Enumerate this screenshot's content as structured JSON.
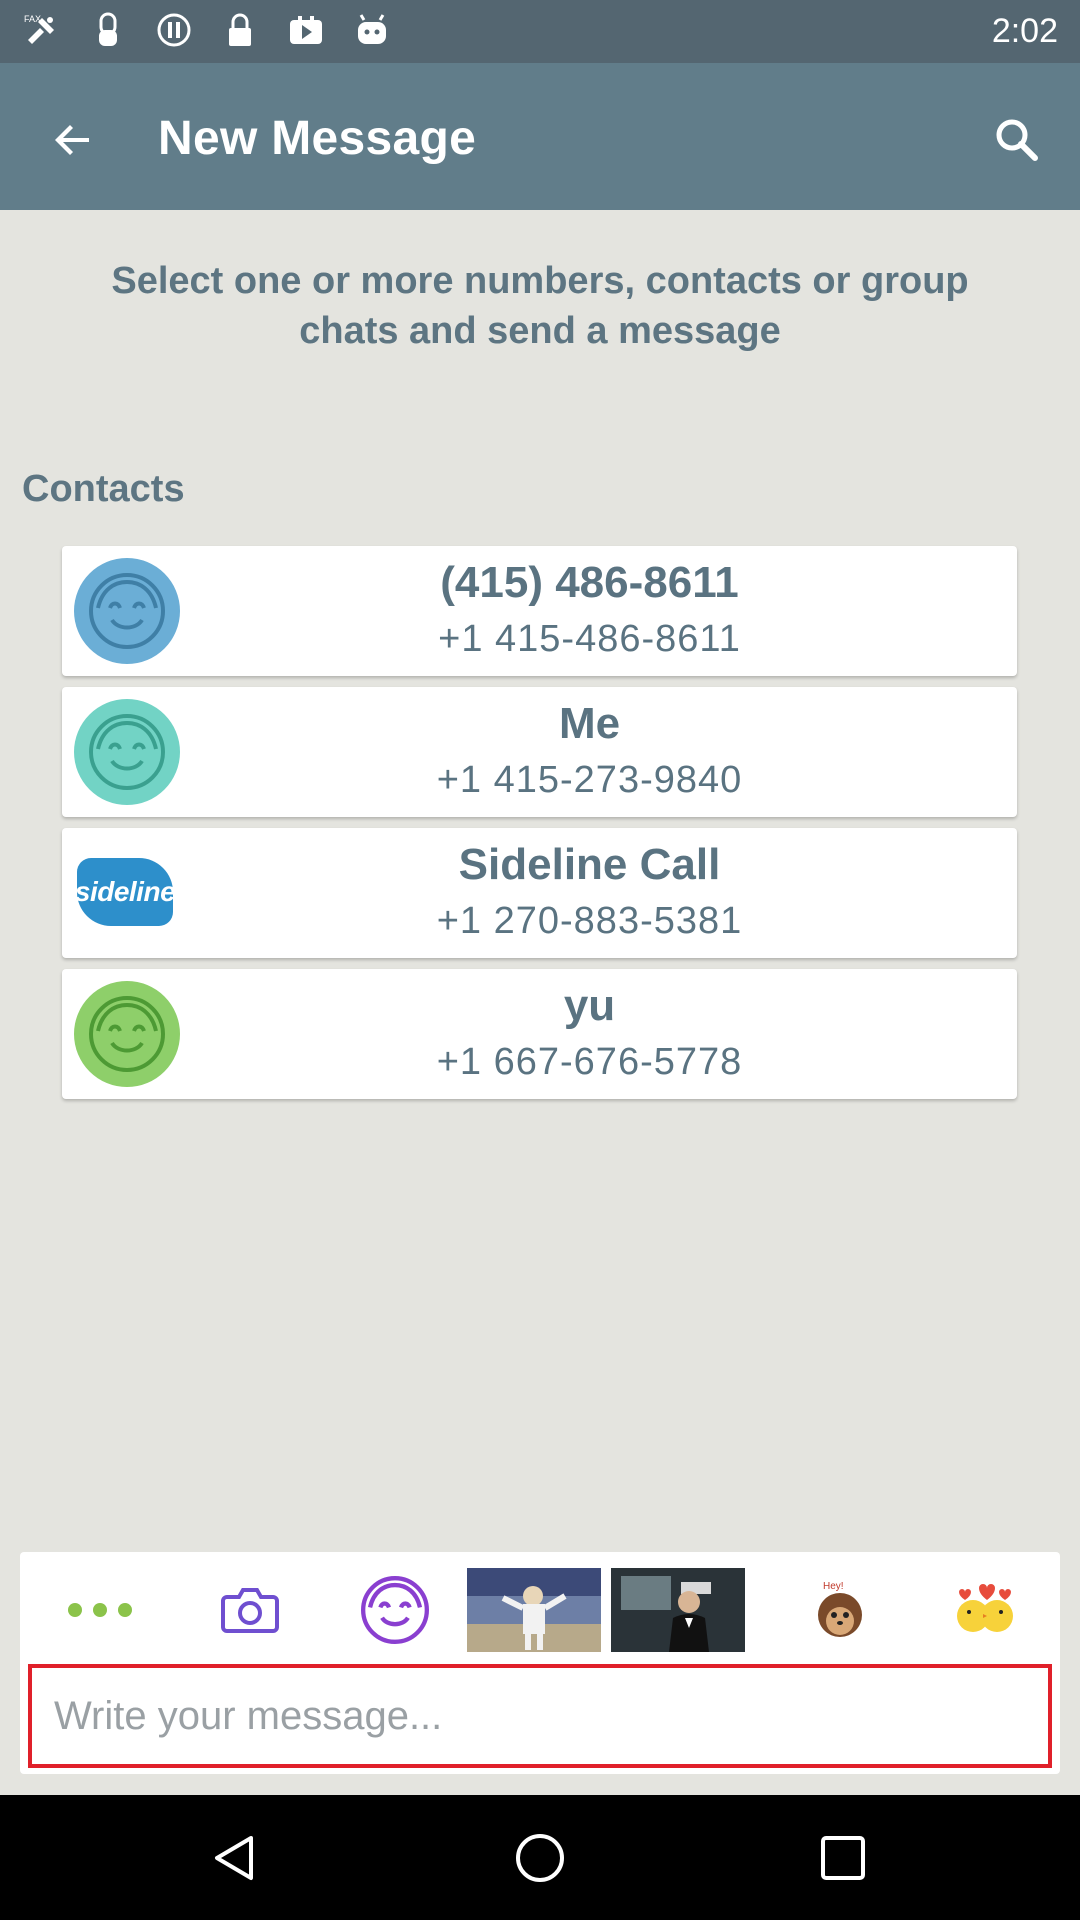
{
  "status_bar": {
    "time": "2:02",
    "icons": [
      "fax-icon",
      "hand-icon",
      "pause-circle-icon",
      "lock-icon",
      "youtube-icon",
      "android-icon"
    ]
  },
  "app_bar": {
    "title": "New Message",
    "back_icon": "arrow-back-icon",
    "search_icon": "search-icon"
  },
  "instruction": "Select one or more numbers, contacts or group chats and send a message",
  "contacts": {
    "title": "Contacts",
    "items": [
      {
        "name": "(415) 486-8611",
        "number": "+1 415-486-8611",
        "avatar": "smiley-avatar",
        "color": "#6baed6"
      },
      {
        "name": "Me",
        "number": "+1 415-273-9840",
        "avatar": "smiley-avatar",
        "color": "#72d3c5"
      },
      {
        "name": "Sideline Call",
        "number": "+1 270-883-5381",
        "avatar": "sideline-logo",
        "logo_text": "sideline",
        "color": "#2d8fcb"
      },
      {
        "name": "yu",
        "number": "+1 667-676-5778",
        "avatar": "smiley-avatar",
        "color": "#8ecf6a"
      }
    ]
  },
  "composer": {
    "placeholder": "Write your message...",
    "attachments": [
      "more-icon",
      "camera-icon",
      "smiley-icon",
      "gif-thumbnail-1",
      "gif-thumbnail-2",
      "hedgehog-sticker",
      "kissing-chicks-sticker"
    ]
  },
  "nav_bar": {
    "buttons": [
      "back-triangle-icon",
      "home-circle-icon",
      "recents-square-icon"
    ]
  },
  "colors": {
    "status_bar": "#546671",
    "app_bar": "#617d8a",
    "background": "#e4e4df",
    "accent_text": "#5a7381",
    "input_border": "#e0202a",
    "attach_icon": "#6f4fd0"
  }
}
